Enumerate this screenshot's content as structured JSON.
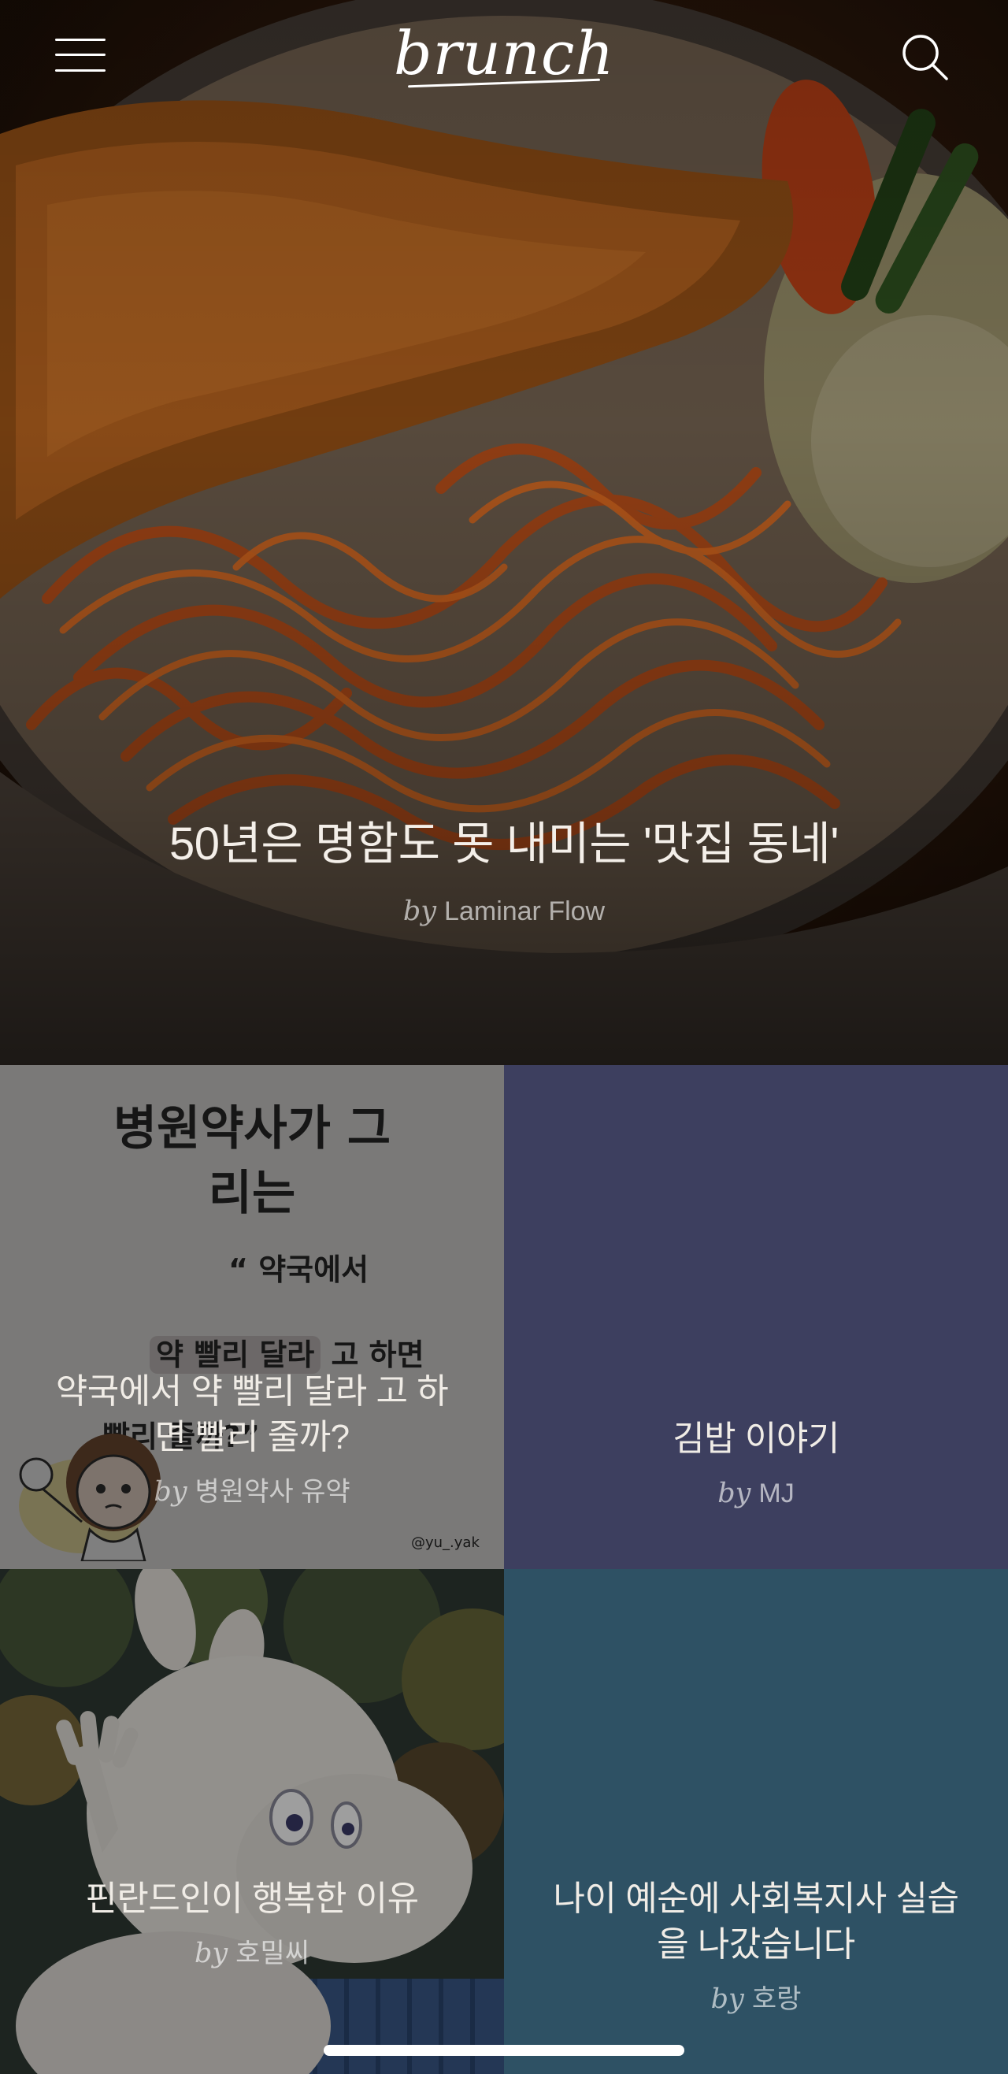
{
  "app": {
    "logo_text": "brunch",
    "menu_icon": "hamburger-menu-icon",
    "search_icon": "magnifier-search-icon"
  },
  "hero": {
    "title": "50년은 명함도 못 내미는 '맛집 동네'",
    "by_label": "by",
    "author": "Laminar Flow",
    "image_subject": "pork cutlet with spaghetti"
  },
  "grid": {
    "tiles": [
      {
        "title": "약국에서 약 빨리 달라 고 하면 빨리 줄까?",
        "by_label": "by",
        "author": "병원약사 유약",
        "background": "#f4f3f1",
        "art": {
          "headline": "병원약사가 그리는",
          "quote_open": "“ 약국에서",
          "highlight": "약 빨리 달라",
          "after_highlight": " 고 하면",
          "line2": "빨리 줄까?”",
          "handle": "@yu_.yak"
        }
      },
      {
        "title": "김밥 이야기",
        "by_label": "by",
        "author": "MJ",
        "background": "#3d3f5f"
      },
      {
        "title": "핀란드인이 행복한 이유",
        "by_label": "by",
        "author": "호밀씨",
        "background": "#3c4a4a"
      },
      {
        "title": "나이 예순에 사회복지사 실습을 나갔습니다",
        "by_label": "by",
        "author": "호랑",
        "background": "#2e5164"
      }
    ]
  }
}
